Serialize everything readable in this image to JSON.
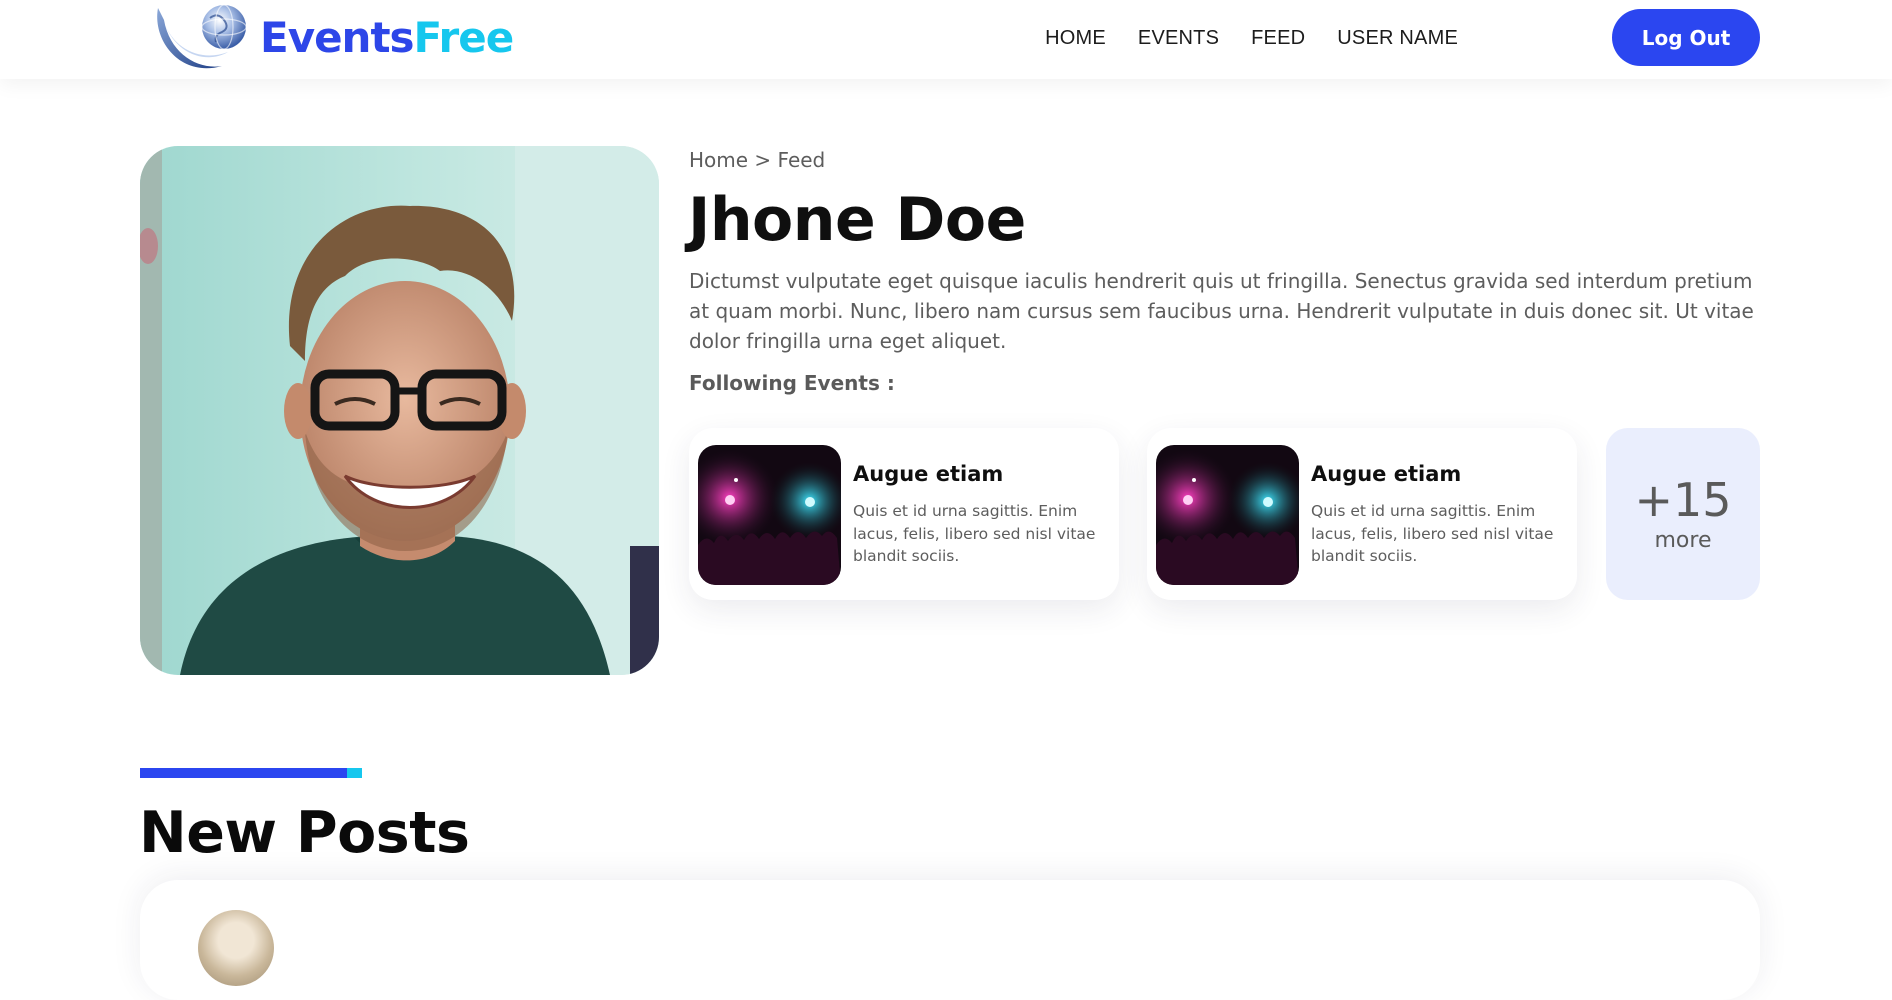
{
  "brand": {
    "part1": "Events",
    "part2": "Free",
    "colors": {
      "primary": "#2d46e8",
      "secondary": "#16c7ee"
    },
    "icon": "globe-swoosh-logo"
  },
  "nav": {
    "items": [
      "HOME",
      "EVENTS",
      "FEED",
      "USER NAME"
    ],
    "logout_label": "Log Out"
  },
  "profile": {
    "breadcrumb": "Home > Feed",
    "name": "Jhone Doe",
    "bio": "Dictumst vulputate eget quisque iaculis hendrerit quis ut fringilla. Senectus gravida sed interdum pretium at quam morbi. Nunc, libero nam cursus sem faucibus urna. Hendrerit vulputate in duis donec sit. Ut vitae dolor fringilla urna eget aliquet.",
    "following_label": "Following Events :",
    "photo": "profile-photo"
  },
  "events": [
    {
      "title": "Augue etiam",
      "description": "Quis et id urna sagittis. Enim lacus, felis, libero sed nisl vitae blandit sociis.",
      "image": "concert-thumbnail"
    },
    {
      "title": "Augue etiam",
      "description": "Quis et id urna sagittis. Enim lacus, felis, libero sed nisl vitae blandit sociis.",
      "image": "concert-thumbnail"
    }
  ],
  "more": {
    "count": "+15",
    "label": "more"
  },
  "posts": {
    "section_title": "New Posts"
  }
}
